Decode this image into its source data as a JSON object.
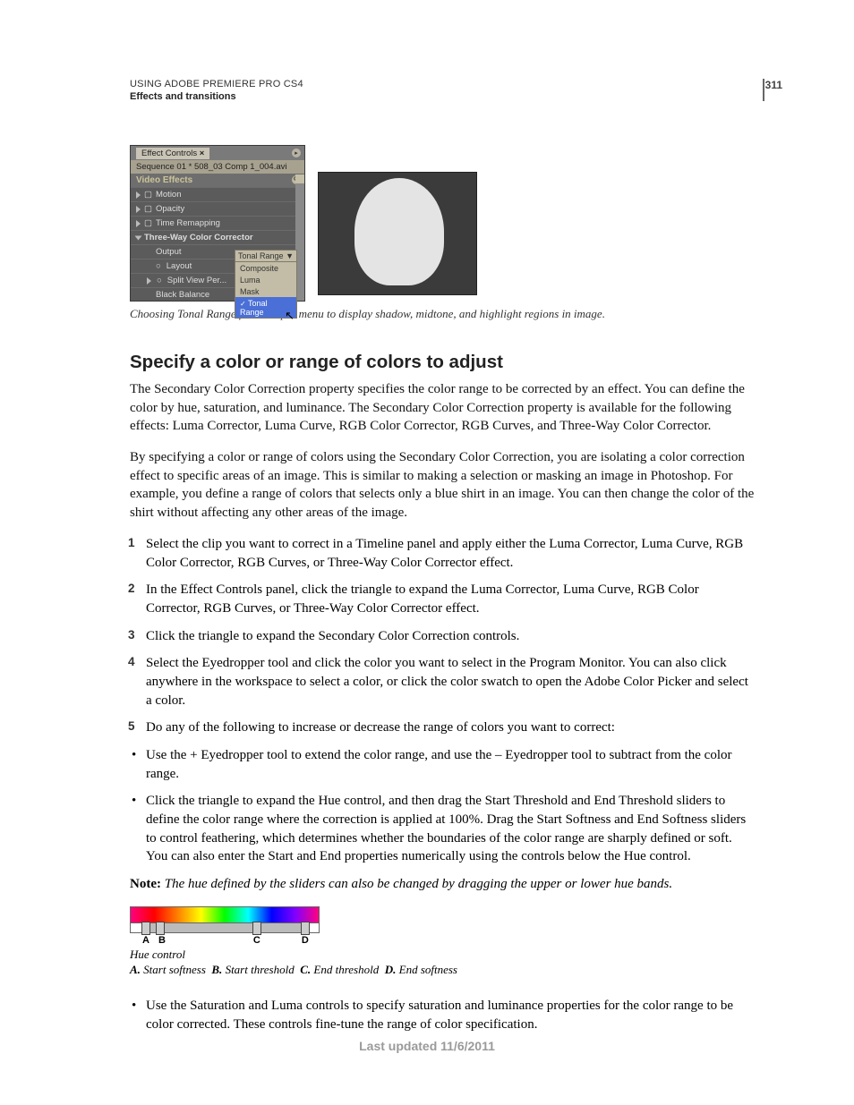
{
  "header": {
    "product": "USING ADOBE PREMIERE PRO CS4",
    "section": "Effects and transitions",
    "page_number": "311"
  },
  "footer": "Last updated 11/6/2011",
  "figure1": {
    "tab": "Effect Controls",
    "sequence": "Sequence 01 * 508_03 Comp 1_004.avi",
    "video_effects": "Video Effects",
    "rows": [
      "Motion",
      "Opacity",
      "Time Remapping",
      "Three-Way Color Corrector"
    ],
    "output_label": "Output",
    "output_value": "Tonal Range",
    "dropdown": [
      "Composite",
      "Luma",
      "Mask",
      "Tonal Range"
    ],
    "layout": "Layout",
    "split": "Split View Per...",
    "black": "Black Balance",
    "caption": "Choosing Tonal Range from Output menu to display shadow, midtone, and highlight regions in image."
  },
  "heading": "Specify a color or range of colors to adjust",
  "p1": "The Secondary Color Correction property specifies the color range to be corrected by an effect. You can define the color by hue, saturation, and luminance. The Secondary Color Correction property is available for the following effects: Luma Corrector, Luma Curve, RGB Color Corrector, RGB Curves, and Three-Way Color Corrector.",
  "p2": "By specifying a color or range of colors using the Secondary Color Correction, you are isolating a color correction effect to specific areas of an image. This is similar to making a selection or masking an image in Photoshop. For example, you define a range of colors that selects only a blue shirt in an image. You can then change the color of the shirt without affecting any other areas of the image.",
  "steps": [
    "Select the clip you want to correct in a Timeline panel and apply either the Luma Corrector, Luma Curve, RGB Color Corrector, RGB Curves, or Three-Way Color Corrector effect.",
    "In the Effect Controls panel, click the triangle to expand the Luma Corrector, Luma Curve, RGB Color Corrector, RGB Curves, or Three-Way Color Corrector effect.",
    "Click the triangle to expand the Secondary Color Correction controls.",
    "Select the Eyedropper tool and click the color you want to select in the Program Monitor. You can also click anywhere in the workspace to select a color, or click the color swatch to open the Adobe Color Picker and select a color.",
    "Do any of the following to increase or decrease the range of colors you want to correct:"
  ],
  "sub_bullets": [
    "Use the + Eyedropper tool to extend the color range, and use the – Eyedropper tool to subtract from the color range.",
    "Click the triangle to expand the Hue control, and then drag the Start Threshold and End Threshold sliders to define the color range where the correction is applied at 100%. Drag the Start Softness and End Softness sliders to control feathering, which determines whether the boundaries of the color range are sharply defined or soft. You can also enter the Start and End properties numerically using the controls below the Hue control."
  ],
  "note_label": "Note:",
  "note_text": "The hue defined by the sliders can also be changed by dragging the upper or lower hue bands.",
  "hue": {
    "labels": [
      "A",
      "B",
      "C",
      "D"
    ],
    "caption1": "Hue control",
    "key": [
      {
        "k": "A.",
        "t": "Start softness"
      },
      {
        "k": "B.",
        "t": "Start threshold"
      },
      {
        "k": "C.",
        "t": "End threshold"
      },
      {
        "k": "D.",
        "t": "End softness"
      }
    ]
  },
  "bullet2": "Use the Saturation and Luma controls to specify saturation and luminance properties for the color range to be color corrected. These controls fine-tune the range of color specification."
}
